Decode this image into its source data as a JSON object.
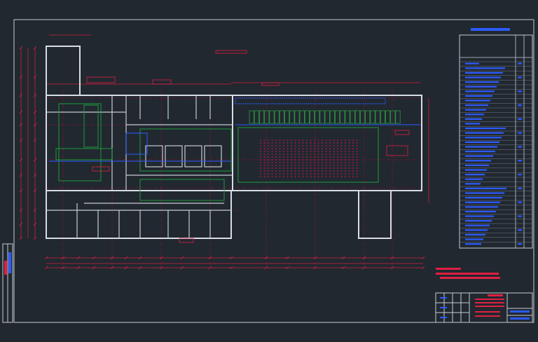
{
  "colors": {
    "background": "#212830",
    "frame": "#c8ccd4",
    "wall": "#d8dce4",
    "dimension": "#d0203a",
    "axis": "#c01838",
    "annotation": "#e02040",
    "green": "#1f9a3a",
    "blue": "#2c5cff",
    "grid_dot": "#c01848"
  },
  "legend_table": {
    "rows": 40
  },
  "title_block": {
    "columns": 4
  },
  "notes": [
    "",
    "",
    ""
  ]
}
